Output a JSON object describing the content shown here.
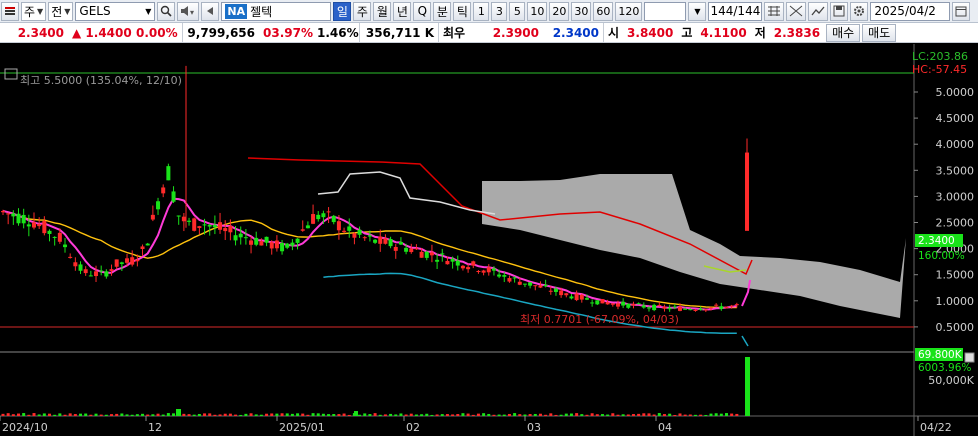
{
  "toolbar": {
    "market_type": "주",
    "list_type": "전",
    "ticker": "GELS",
    "na_badge": "NA",
    "stock_name": "젤텍",
    "period_tabs": [
      "일",
      "주",
      "월",
      "년",
      "Q",
      "분",
      "틱"
    ],
    "active_period": "일",
    "intervals": [
      "1",
      "3",
      "5",
      "10",
      "20",
      "30",
      "60",
      "120"
    ],
    "count": "144/144",
    "date": "2025/04/2"
  },
  "quote": {
    "price": "2.3400",
    "change": "▲ 1.4400",
    "change_pct": "0.00%",
    "volume": "9,799,656",
    "vol_pct": "03.97%",
    "turnover": "1.46%",
    "amount": "356,711 K",
    "best_label": "최우",
    "best_bid": "2.3900",
    "best_ask": "2.3400",
    "open_label": "시",
    "open": "3.8400",
    "high_label": "고",
    "high": "4.1100",
    "low_label": "저",
    "low": "2.3836",
    "buy_label": "매수",
    "sell_label": "매도"
  },
  "chart_labels": {
    "max_label": "최고 5.5000 (135.04%, 12/10)",
    "min_label": "최저 0.7701 (-67.09%, 04/03)",
    "lc": "LC:203.86",
    "hc": "HC:-57.45",
    "price_tag": "2.3400",
    "price_pct_tag": "160.00%",
    "volume_tag": "69.800K",
    "volume_pct_tag": "6003.96%"
  },
  "colors": {
    "up": "#ff2a2a",
    "down": "#19e319",
    "ma_short": "#ff3bd8",
    "ma_long": "#ffc20e",
    "bollinger": "#1aa6c2",
    "cloud": "#bdbdbd",
    "envelope": "#e00000"
  },
  "chart_data": {
    "type": "candlestick",
    "y_axis_ticks": [
      "5.0000",
      "4.5000",
      "4.0000",
      "3.5000",
      "3.0000",
      "2.5000",
      "2.0000",
      "1.5000",
      "1.0000",
      "0.5000"
    ],
    "volume_axis_ticks": [
      "50,000K"
    ],
    "x_axis_ticks": [
      "2024/10",
      "12",
      "2025/01",
      "02",
      "03",
      "04",
      "04/22"
    ],
    "ylim": [
      0,
      5.8
    ],
    "last_close": 2.34,
    "period_high": 5.5,
    "period_low": 0.7701
  }
}
